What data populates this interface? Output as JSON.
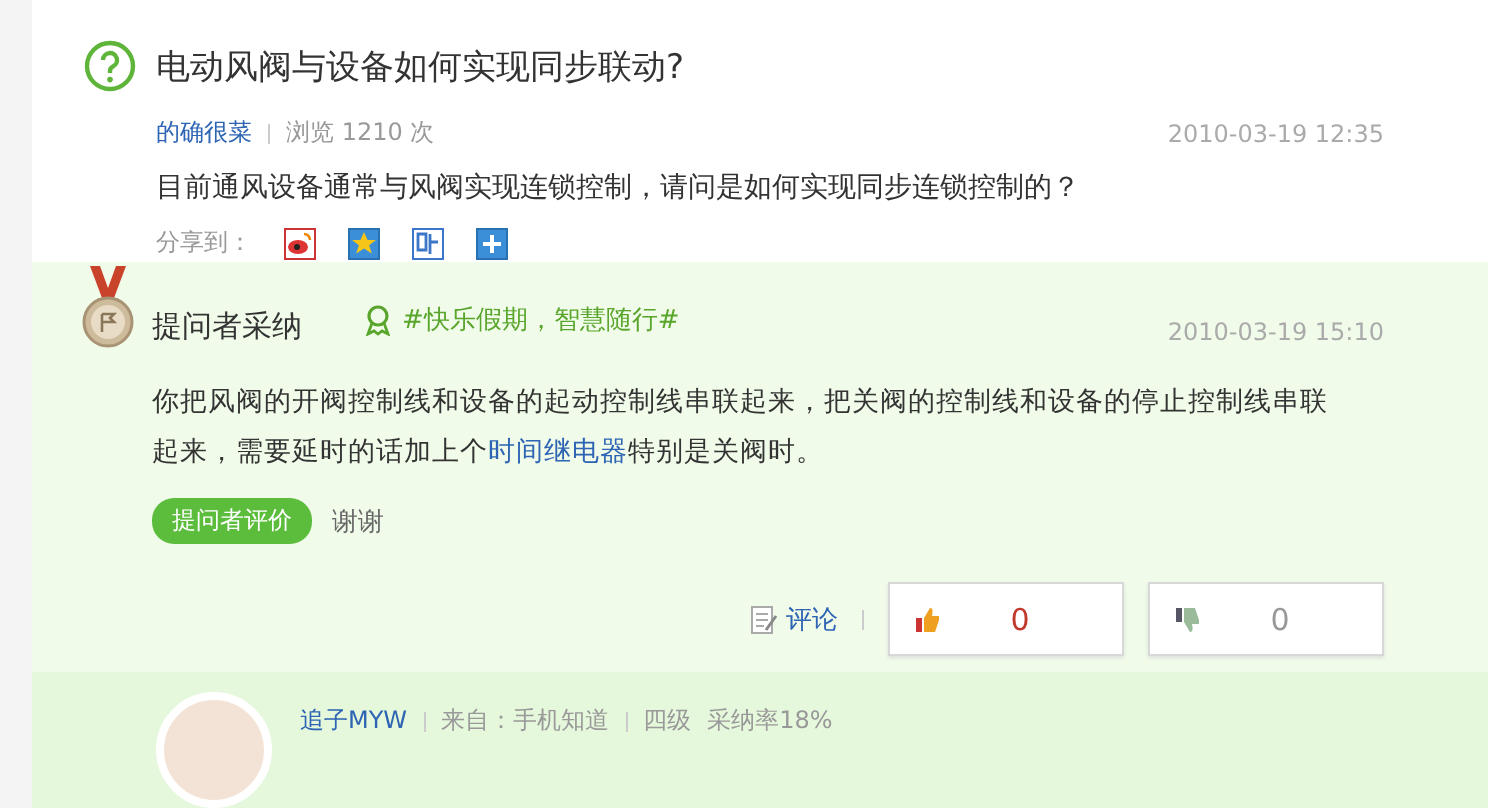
{
  "question": {
    "title": "电动风阀与设备如何实现同步联动?",
    "author": "的确很菜",
    "views": "浏览 1210 次",
    "date": "2010-03-19 12:35",
    "content": "目前通风设备通常与风阀实现连锁控制，请问是如何实现同步连锁控制的？",
    "share_label": "分享到："
  },
  "answer": {
    "badge": "提问者采纳",
    "tag": "#快乐假期，智慧随行#",
    "date": "2010-03-19 15:10",
    "content": [
      {
        "kind": "text",
        "text": "你把风阀的开阀控制线和设备的起动控制线串联起来，把关阀的控制线和设备的停止控制线串联起来，需要延时的话加上个"
      },
      {
        "kind": "link",
        "text": "时间继电器"
      },
      {
        "kind": "text",
        "text": "特别是关阀时。"
      }
    ],
    "rate_button": "提问者评价",
    "thanks": "谢谢",
    "comment": "评论",
    "likes": "0",
    "dislikes": "0"
  },
  "next_answer": {
    "author": "追子MYW",
    "source": "来自：手机知道",
    "level": "四级",
    "rate": "采纳率18%"
  }
}
